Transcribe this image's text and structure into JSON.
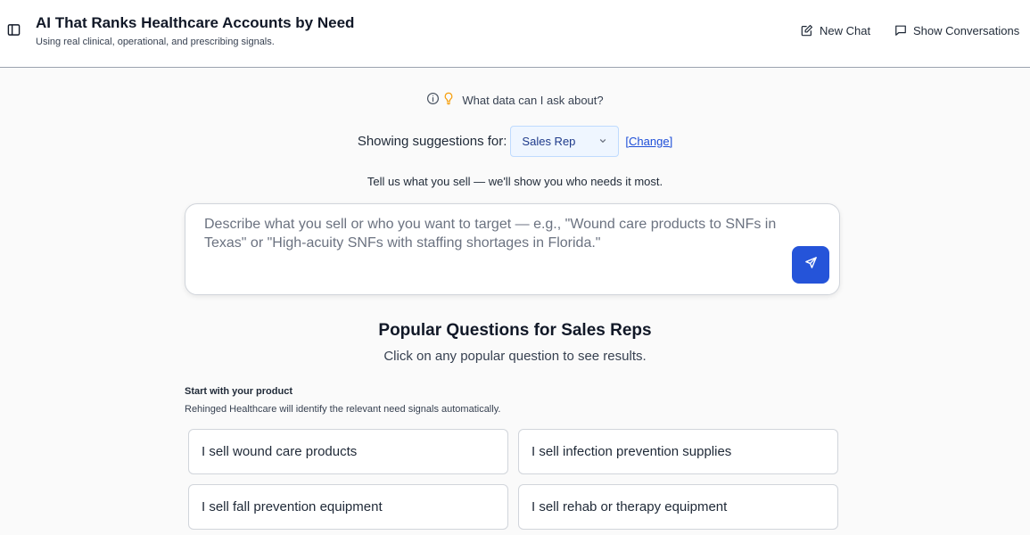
{
  "header": {
    "title": "AI That Ranks Healthcare Accounts by Need",
    "subtitle": "Using real clinical, operational, and prescribing signals.",
    "new_chat_label": "New Chat",
    "show_conversations_label": "Show Conversations"
  },
  "info": {
    "label": "What data can I ask about?"
  },
  "suggestions": {
    "label": "Showing suggestions for:",
    "selected_role": "Sales Rep",
    "change_label": "[Change]"
  },
  "tagline": "Tell us what you sell — we'll show you who needs it most.",
  "prompt": {
    "placeholder": "Describe what you sell or who you want to target — e.g., \"Wound care products to SNFs in Texas\" or \"High-acuity SNFs with staffing shortages in Florida.\"",
    "value": ""
  },
  "popular": {
    "title": "Popular Questions for Sales Reps",
    "subtitle": "Click on any popular question to see results.",
    "section_title": "Start with your product",
    "section_desc": "Rehinged Healthcare will identify the relevant need signals automatically.",
    "questions": [
      "I sell wound care products",
      "I sell infection prevention supplies",
      "I sell fall prevention equipment",
      "I sell rehab or therapy equipment"
    ]
  },
  "colors": {
    "accent": "#2554d9",
    "link": "#1d4ed8",
    "bulb": "#f59e0b"
  }
}
